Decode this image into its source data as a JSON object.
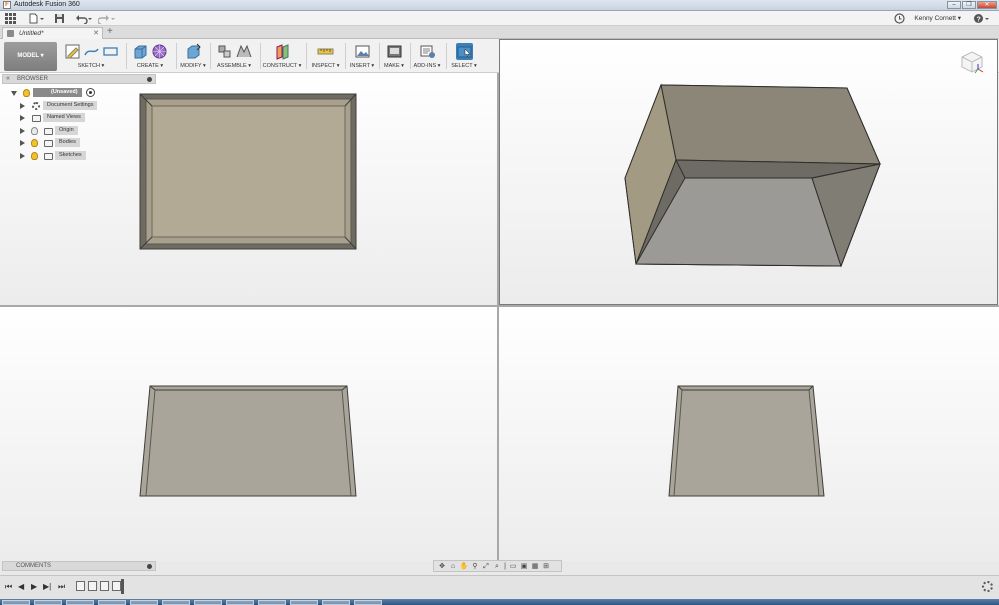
{
  "window": {
    "title": "Autodesk Fusion 360",
    "app_icon": "F"
  },
  "qat": {
    "user": "Kenny Cornett ▾"
  },
  "tab": {
    "label": "Untitled*",
    "close": "✕",
    "new": "+"
  },
  "toolbar": {
    "workspace": "MODEL ▾",
    "groups": {
      "sketch": "SKETCH ▾",
      "create": "CREATE ▾",
      "modify": "MODIFY ▾",
      "assemble": "ASSEMBLE ▾",
      "construct": "CONSTRUCT ▾",
      "inspect": "INSPECT ▾",
      "insert": "INSERT ▾",
      "make": "MAKE ▾",
      "addins": "ADD-INS ▾",
      "select": "SELECT ▾"
    }
  },
  "browser": {
    "title": "BROWSER",
    "items": [
      {
        "label": "(Unsaved)"
      },
      {
        "label": "Document Settings"
      },
      {
        "label": "Named Views"
      },
      {
        "label": "Origin"
      },
      {
        "label": "Bodies"
      },
      {
        "label": "Sketches"
      }
    ]
  },
  "comments": {
    "title": "COMMENTS"
  },
  "colors": {
    "active_blue": "#3c7fb8",
    "model_fill": "#a89f8d",
    "bulb": "#f2c12e"
  }
}
